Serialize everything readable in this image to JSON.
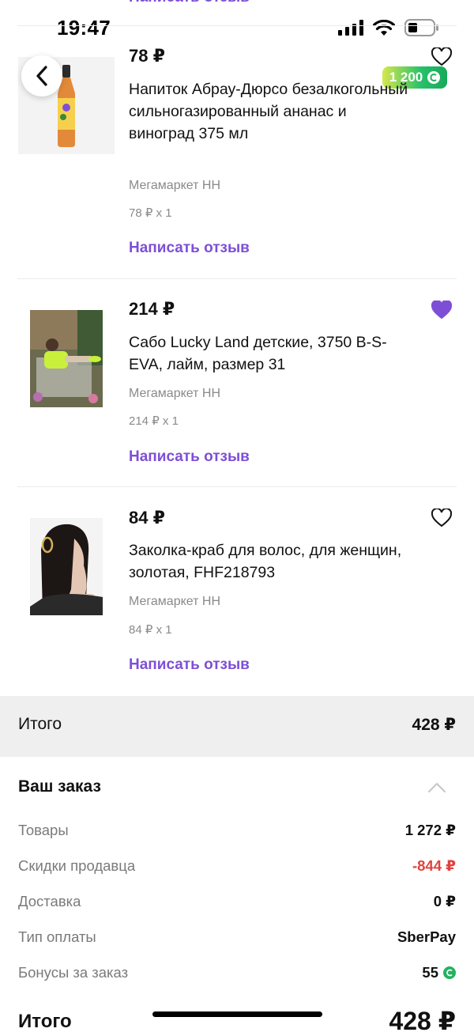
{
  "status": {
    "time": "19:47"
  },
  "top_partial_link": "Написать отзыв",
  "items": [
    {
      "price": "78 ₽",
      "title": "Напиток Абрау-Дюрсо безалкогольный сильногазированный ананас и виноград 375 мл",
      "seller": "Мегамаркет НН",
      "qty": "78 ₽ x 1",
      "review": "Написать отзыв",
      "bonus": "1 200",
      "favorite": false
    },
    {
      "price": "214 ₽",
      "title": "Сабо Lucky Land детские, 3750 B-S-EVA, лайм, размер 31",
      "seller": "Мегамаркет НН",
      "qty": "214 ₽ x 1",
      "review": "Написать отзыв",
      "favorite": true
    },
    {
      "price": "84 ₽",
      "title": "Заколка-краб для волос, для женщин, золотая, FHF218793",
      "seller": "Мегамаркет НН",
      "qty": "84 ₽ x 1",
      "review": "Написать отзыв",
      "favorite": false
    }
  ],
  "total": {
    "label": "Итого",
    "value": "428 ₽"
  },
  "order": {
    "title": "Ваш заказ",
    "rows": [
      {
        "label": "Товары",
        "value": "1 272 ₽"
      },
      {
        "label": "Скидки продавца",
        "value": "-844 ₽"
      },
      {
        "label": "Доставка",
        "value": "0 ₽"
      },
      {
        "label": "Тип оплаты",
        "value": "SberPay"
      },
      {
        "label": "Бонусы за заказ",
        "value": "55"
      }
    ]
  },
  "bottom_total": {
    "label": "Итого",
    "value": "428 ₽"
  },
  "colors": {
    "accent": "#7d4fd6",
    "negative": "#e0433e",
    "bonus": "#21b35f"
  }
}
